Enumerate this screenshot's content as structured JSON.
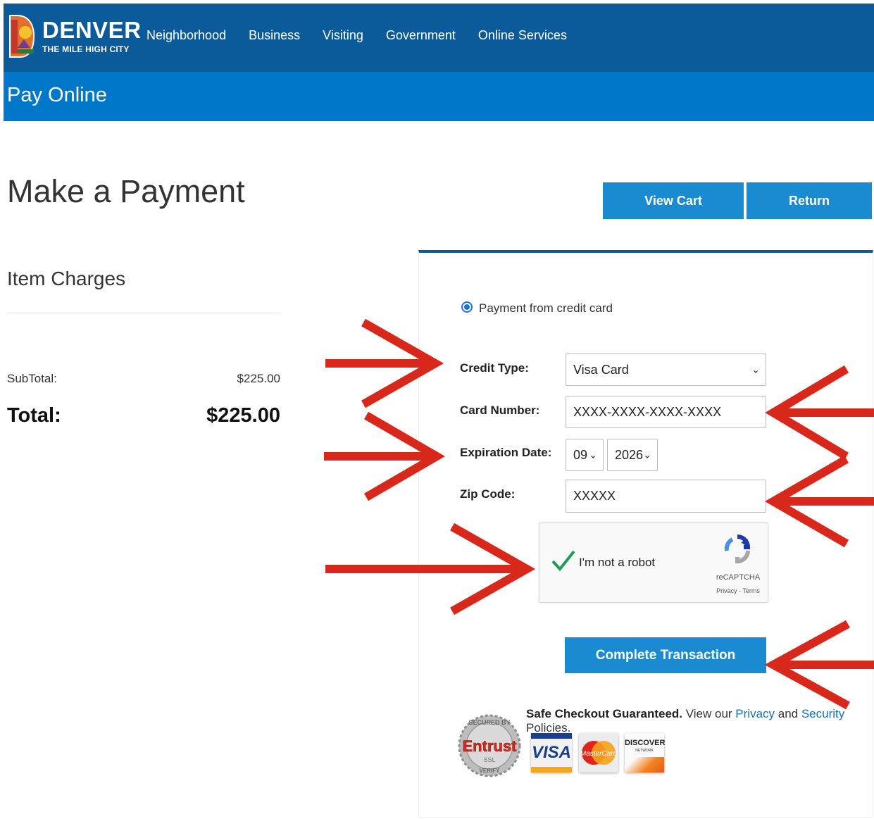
{
  "header": {
    "brand_name": "DENVER",
    "brand_tagline": "THE MILE HIGH CITY",
    "nav": [
      "Neighborhood",
      "Business",
      "Visiting",
      "Government",
      "Online Services"
    ],
    "section_title": "Pay Online"
  },
  "page": {
    "title": "Make a Payment",
    "view_cart_label": "View Cart",
    "return_label": "Return"
  },
  "charges": {
    "heading": "Item Charges",
    "subtotal_label": "SubTotal:",
    "subtotal_value": "$225.00",
    "total_label": "Total:",
    "total_value": "$225.00"
  },
  "payment": {
    "method_label": "Payment from credit card",
    "credit_type_label": "Credit Type:",
    "credit_type_value": "Visa Card",
    "card_number_label": "Card Number:",
    "card_number_value": "XXXX-XXXX-XXXX-XXXX",
    "expiration_label": "Expiration Date:",
    "exp_month": "09",
    "exp_year": "2026",
    "zip_label": "Zip Code:",
    "zip_value": "XXXXX",
    "complete_label": "Complete Transaction"
  },
  "captcha": {
    "label": "I'm not a robot",
    "brand": "reCAPTCHA",
    "privacy": "Privacy",
    "sep": " - ",
    "terms": "Terms"
  },
  "safe_checkout": {
    "bold": "Safe Checkout Guaranteed.",
    "text1": " View our ",
    "privacy": "Privacy",
    "text2": " and ",
    "security": "Security",
    "text3": " Policies."
  },
  "seal": {
    "top": "SECURED BY",
    "brand": "Entrust",
    "mid": "SSL",
    "bottom": "VERIFY"
  },
  "cards": {
    "visa": "VISA",
    "mastercard": "MasterCard",
    "discover": "DISCOVER",
    "discover_sub": "NETWORK"
  },
  "colors": {
    "header_dark": "#0b5a99",
    "header_light": "#0077c8",
    "button_blue": "#1b8bd1",
    "arrow_red": "#d8281c",
    "check_green": "#1a9e55"
  }
}
